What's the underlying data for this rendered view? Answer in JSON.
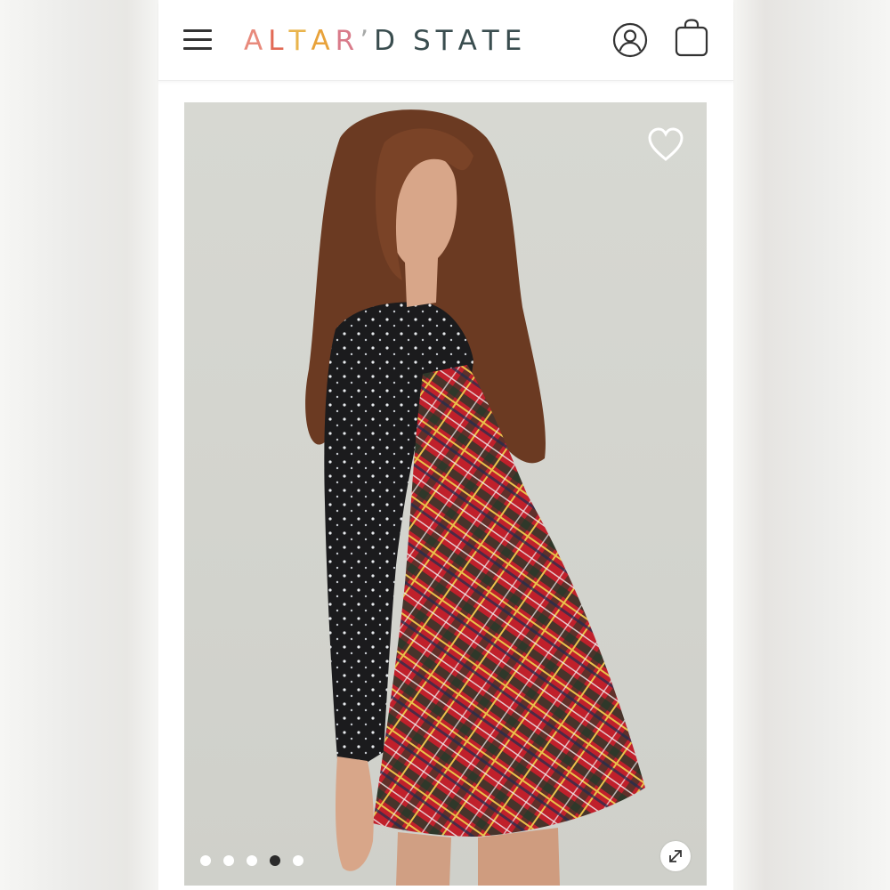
{
  "header": {
    "menu_icon": "hamburger-menu-icon",
    "logo": {
      "letters": [
        {
          "ch": "A",
          "color": "#e88a7c"
        },
        {
          "ch": "L",
          "color": "#e26a55"
        },
        {
          "ch": "T",
          "color": "#e9b44c"
        },
        {
          "ch": "A",
          "color": "#e8a23a"
        },
        {
          "ch": "R",
          "color": "#d97b8a"
        },
        {
          "ch": "’",
          "color": "#a7a9a8"
        },
        {
          "ch": "D",
          "color": "#3a4d4f"
        },
        {
          "ch": " ",
          "color": "#000000"
        },
        {
          "ch": "S",
          "color": "#3a4d4f"
        },
        {
          "ch": "T",
          "color": "#3a4d4f"
        },
        {
          "ch": "A",
          "color": "#3a4d4f"
        },
        {
          "ch": "T",
          "color": "#3a4d4f"
        },
        {
          "ch": "E",
          "color": "#3a4d4f"
        }
      ],
      "text": "ALTAR’D STATE"
    },
    "account_icon": "account-user-icon",
    "bag_icon": "shopping-bag-icon"
  },
  "gallery": {
    "image_alt": "Model wearing red plaid mini dress over black embellished mesh top",
    "favorite_icon": "heart-outline-icon",
    "expand_icon": "expand-arrows-icon",
    "slide_count": 5,
    "active_slide": 4
  },
  "colors": {
    "plaid_red": "#c0202b",
    "mesh_black": "#1a1a1a",
    "backdrop": "#d6d7d1",
    "accent_dark": "#2b2b2b"
  }
}
